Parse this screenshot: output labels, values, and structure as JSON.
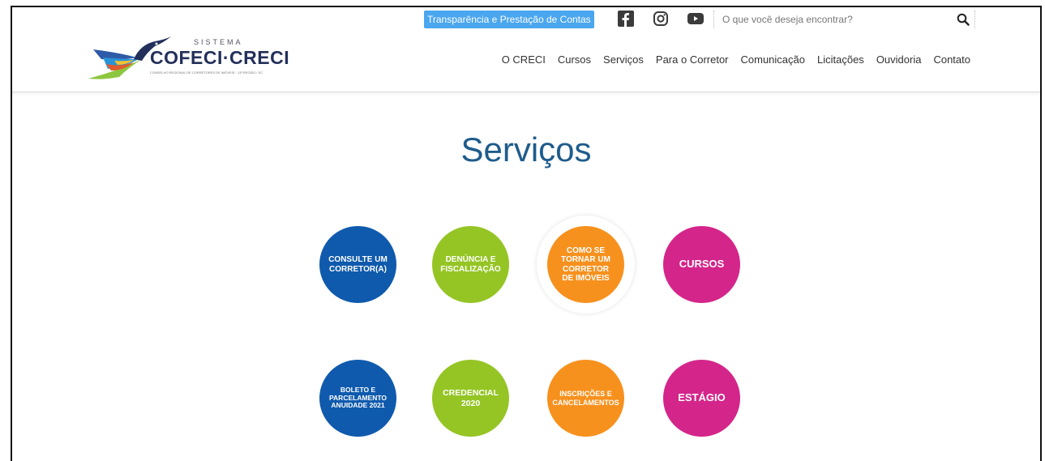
{
  "header": {
    "logo": {
      "sistema": "SISTEMA",
      "brand": "COFECI·CRECI",
      "subtitle": "CONSELHO REGIONAL DE CORRETORES DE IMÓVEIS · 11ª REGIÃO / SC"
    },
    "transparency_link": "Transparência e Prestação de Contas",
    "social": [
      "facebook-icon",
      "instagram-icon",
      "youtube-icon"
    ],
    "search": {
      "placeholder": "O que você deseja encontrar?"
    },
    "nav": [
      "O CRECI",
      "Cursos",
      "Serviços",
      "Para o Corretor",
      "Comunicação",
      "Licitações",
      "Ouvidoria",
      "Contato"
    ]
  },
  "main": {
    "title": "Serviços",
    "services": [
      {
        "label": "CONSULTE UM CORRETOR(A)",
        "color": "#0f5aad"
      },
      {
        "label": "DENÚNCIA E FISCALIZAÇÃO",
        "color": "#95c525"
      },
      {
        "label": "COMO SE TORNAR UM CORRETOR DE IMÓVEIS",
        "color": "#f7911e"
      },
      {
        "label": "CURSOS",
        "color": "#d4258a"
      },
      {
        "label": "BOLETO E PARCELAMENTO ANUIDADE 2021",
        "color": "#0f5aad"
      },
      {
        "label": "CREDENCIAL 2020",
        "color": "#95c525"
      },
      {
        "label": "INSCRIÇÕES E CANCELAMENTOS",
        "color": "#f7911e"
      },
      {
        "label": "ESTÁGIO",
        "color": "#d4258a"
      }
    ]
  }
}
